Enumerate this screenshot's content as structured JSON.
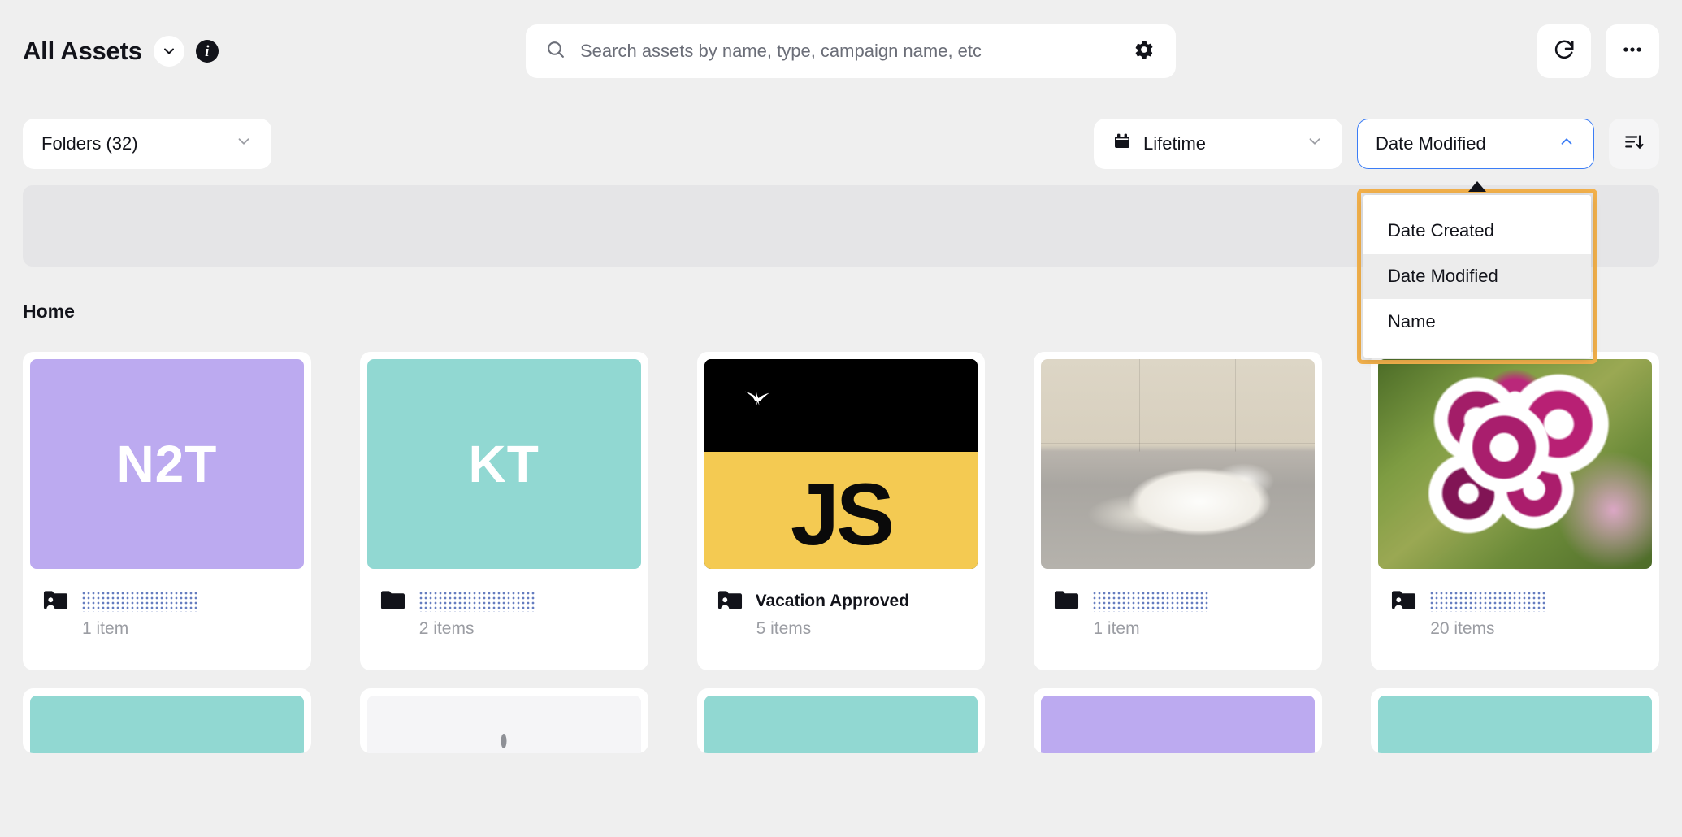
{
  "header": {
    "title": "All Assets",
    "chevron_icon": "chevron-down-icon",
    "info_icon": "info-icon",
    "info_glyph": "i"
  },
  "search": {
    "placeholder": "Search assets by name, type, campaign name, etc",
    "value": "",
    "search_icon": "search-icon",
    "settings_icon": "gear-icon"
  },
  "toolbar": {
    "refresh_icon": "refresh-icon",
    "more_icon": "more-horizontal-icon"
  },
  "filters": {
    "folders": {
      "label": "Folders (32)",
      "chevron": "chevron-down-icon"
    },
    "date_range": {
      "label": "Lifetime",
      "icon": "calendar-icon",
      "chevron": "chevron-down-icon"
    },
    "sort_field": {
      "label": "Date Modified",
      "chevron": "chevron-up-icon",
      "active_border": "#3b7df6"
    },
    "sort_direction_icon": "sort-descending-icon"
  },
  "sort_menu": {
    "open": true,
    "highlight_color": "#f2b04b",
    "selected": "Date Modified",
    "items": [
      {
        "label": "Date Created"
      },
      {
        "label": "Date Modified"
      },
      {
        "label": "Name"
      }
    ]
  },
  "breadcrumb": {
    "current": "Home"
  },
  "assets": [
    {
      "initials": "N2T",
      "thumb_color": "#bcaaf0",
      "thumb_kind": "initials",
      "name": "",
      "name_redacted": true,
      "count": "1 item",
      "folder_icon": "shared-folder-icon"
    },
    {
      "initials": "KT",
      "thumb_color": "#91d8d2",
      "thumb_kind": "initials",
      "name": "",
      "name_redacted": true,
      "count": "2 items",
      "folder_icon": "folder-icon"
    },
    {
      "initials": "JS",
      "thumb_color": "#f4ca52",
      "thumb_kind": "js",
      "name": "Vacation Approved",
      "name_redacted": false,
      "count": "5 items",
      "folder_icon": "shared-folder-icon"
    },
    {
      "initials": "",
      "thumb_color": "#d7cfbe",
      "thumb_kind": "dog-photo",
      "name": "",
      "name_redacted": true,
      "count": "1 item",
      "folder_icon": "folder-icon"
    },
    {
      "initials": "",
      "thumb_color": "#7f9b46",
      "thumb_kind": "flower-photo",
      "name": "",
      "name_redacted": true,
      "count": "20 items",
      "folder_icon": "shared-folder-icon"
    }
  ],
  "assets_next_row": [
    {
      "thumb_color": "#91d8d2",
      "has_dot": false
    },
    {
      "thumb_color": "#f5f5f7",
      "has_dot": true
    },
    {
      "thumb_color": "#91d8d2",
      "has_dot": false
    },
    {
      "thumb_color": "#bcaaf0",
      "has_dot": false
    },
    {
      "thumb_color": "#91d8d2",
      "has_dot": false
    }
  ]
}
